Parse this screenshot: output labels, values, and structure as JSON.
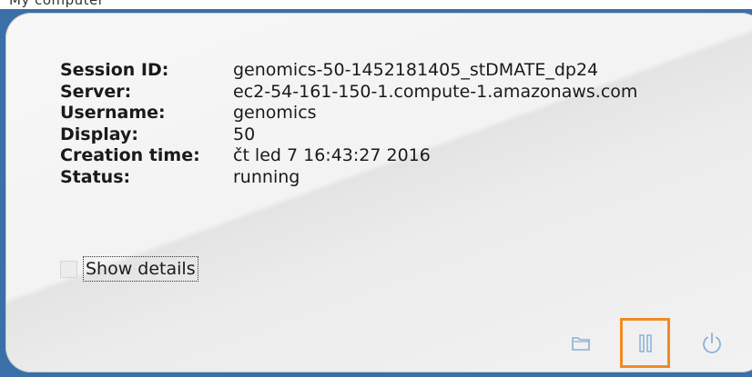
{
  "top_strip": {
    "text": "My computer"
  },
  "session": {
    "fields": [
      {
        "label": "Session ID:",
        "value": "genomics-50-1452181405_stDMATE_dp24"
      },
      {
        "label": "Server:",
        "value": "ec2-54-161-150-1.compute-1.amazonaws.com"
      },
      {
        "label": "Username:",
        "value": "genomics"
      },
      {
        "label": "Display:",
        "value": "50"
      },
      {
        "label": "Creation time:",
        "value": "čt led 7 16:43:27 2016"
      },
      {
        "label": "Status:",
        "value": "running"
      }
    ],
    "show_details": {
      "label": "Show details",
      "checked": false
    }
  },
  "actions": {
    "folder": {
      "icon": "folder-icon"
    },
    "pause": {
      "icon": "pause-icon",
      "highlight_color": "#f08a24"
    },
    "power": {
      "icon": "power-icon"
    }
  },
  "colors": {
    "frame": "#3a6fa8",
    "highlight": "#f08a24",
    "icon": "#8ab0d8"
  }
}
